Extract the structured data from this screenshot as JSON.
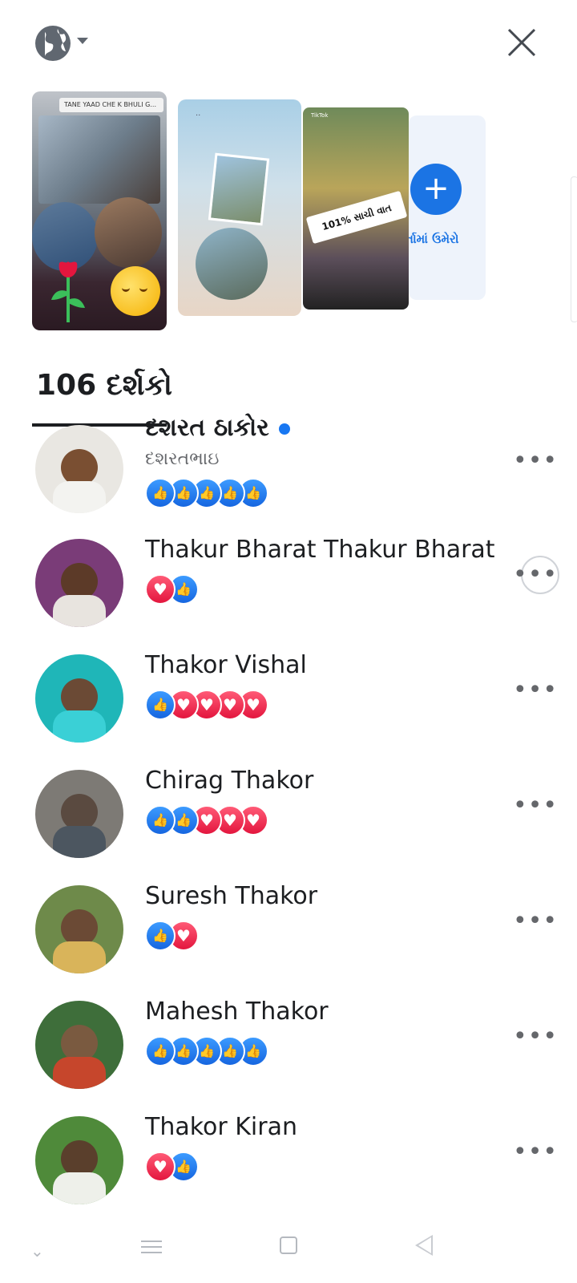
{
  "header": {
    "globe_icon": "globe-icon",
    "close_icon": "close-icon"
  },
  "stories": {
    "story1_caption": "TANE YAAD CHE K BHULI G...",
    "story3_tag": "101% સાચી વાત",
    "story3_tiktok": "TikTok",
    "add_label": "ર્તામાં ઉમેરો",
    "add_icon": "plus-icon"
  },
  "viewers": {
    "count_label": "106 દર્શકો",
    "items": [
      {
        "name": "દશરત ઠાકોર",
        "subname": "દશરતભાઇ",
        "verified": true,
        "reactions": [
          "like",
          "like",
          "like",
          "like",
          "like"
        ]
      },
      {
        "name": "Thakur Bharat Thakur Bharat",
        "reactions": [
          "love",
          "like"
        ]
      },
      {
        "name": "Thakor Vishal",
        "reactions": [
          "like",
          "love",
          "love",
          "love",
          "love"
        ]
      },
      {
        "name": "Chirag Thakor",
        "reactions": [
          "like",
          "like",
          "love",
          "love",
          "love"
        ]
      },
      {
        "name": "Suresh Thakor",
        "reactions": [
          "like",
          "love"
        ]
      },
      {
        "name": "Mahesh Thakor",
        "reactions": [
          "like",
          "like",
          "like",
          "like",
          "like"
        ]
      },
      {
        "name": "Thakor Kiran",
        "reactions": [
          "love",
          "like"
        ]
      }
    ],
    "more_label": "•••"
  },
  "colors": {
    "accent": "#1b74e4",
    "like": "#1877f2",
    "love": "#e3163e"
  },
  "navbar": {
    "icons": [
      "chevron-down-icon",
      "menu-icon",
      "home-square-icon",
      "back-triangle-icon"
    ]
  }
}
